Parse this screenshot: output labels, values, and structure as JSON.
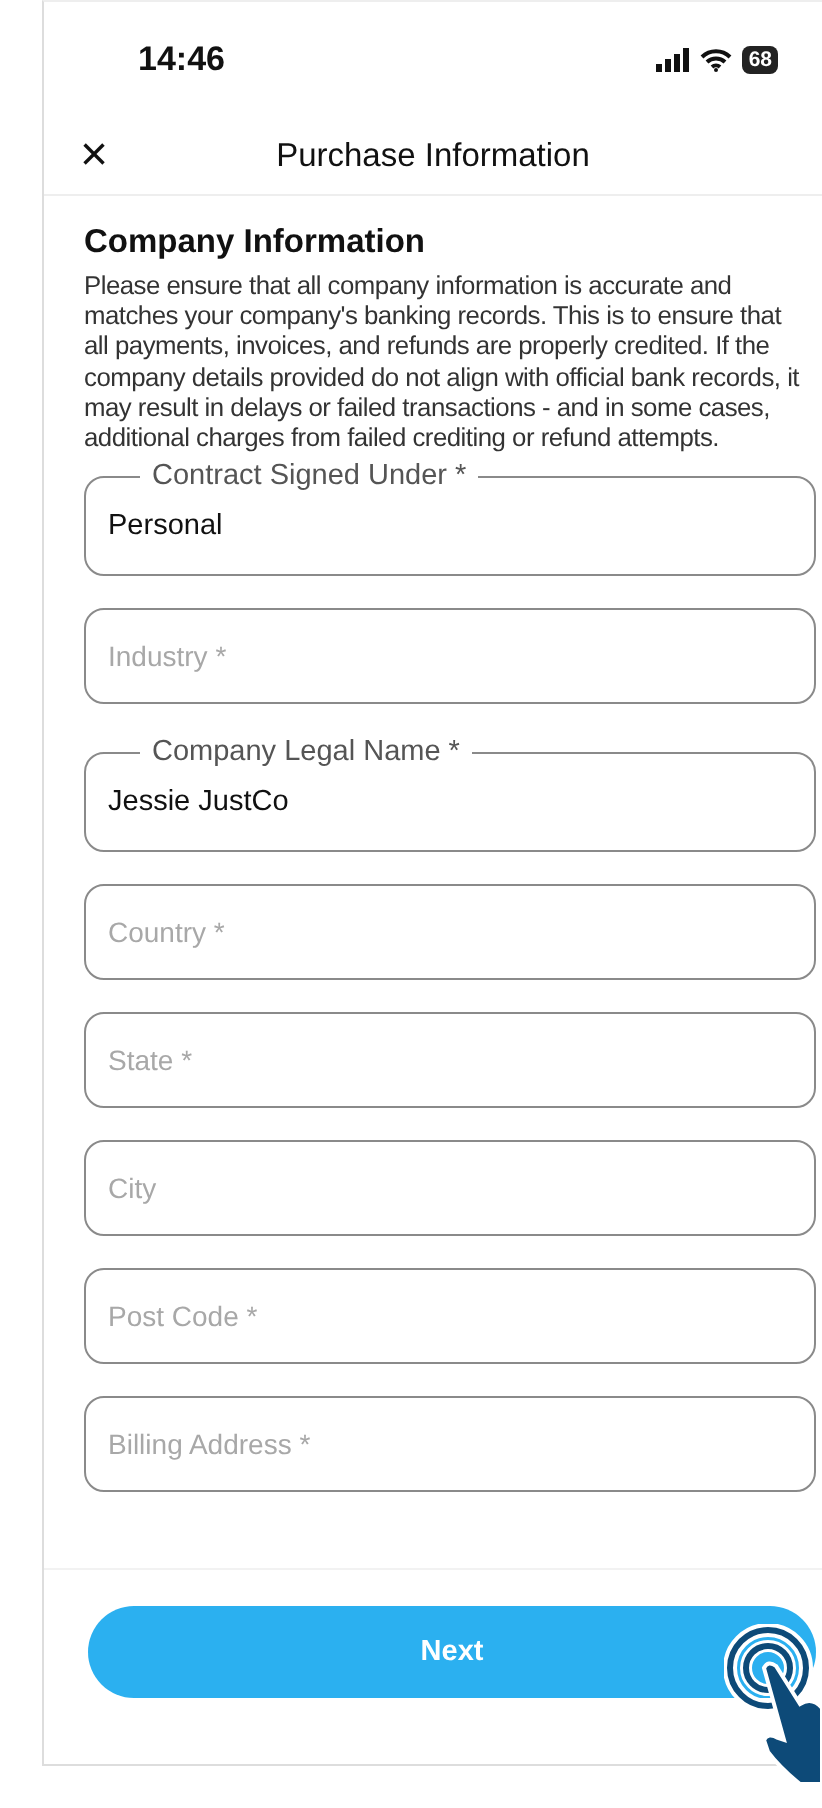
{
  "status_bar": {
    "time": "14:46",
    "battery": "68"
  },
  "header": {
    "close": "×",
    "title": "Purchase Information"
  },
  "section": {
    "heading": "Company Information",
    "description": "Please ensure that all company information is accurate and matches your company's banking records. This is to ensure that all payments, invoices, and refunds are properly credited. If the company details provided do not align with official bank records, it may result in delays or failed transactions - and in some cases, additional charges from failed crediting or refund attempts."
  },
  "fields": [
    {
      "label": "Contract Signed Under *",
      "value": "Personal"
    },
    {
      "placeholder": "Industry *"
    },
    {
      "label": "Company Legal Name *",
      "value": "Jessie JustCo"
    },
    {
      "placeholder": "Country *"
    },
    {
      "placeholder": "State *"
    },
    {
      "placeholder": "City"
    },
    {
      "placeholder": "Post Code *"
    },
    {
      "placeholder": "Billing Address *"
    }
  ],
  "next_button": "Next"
}
